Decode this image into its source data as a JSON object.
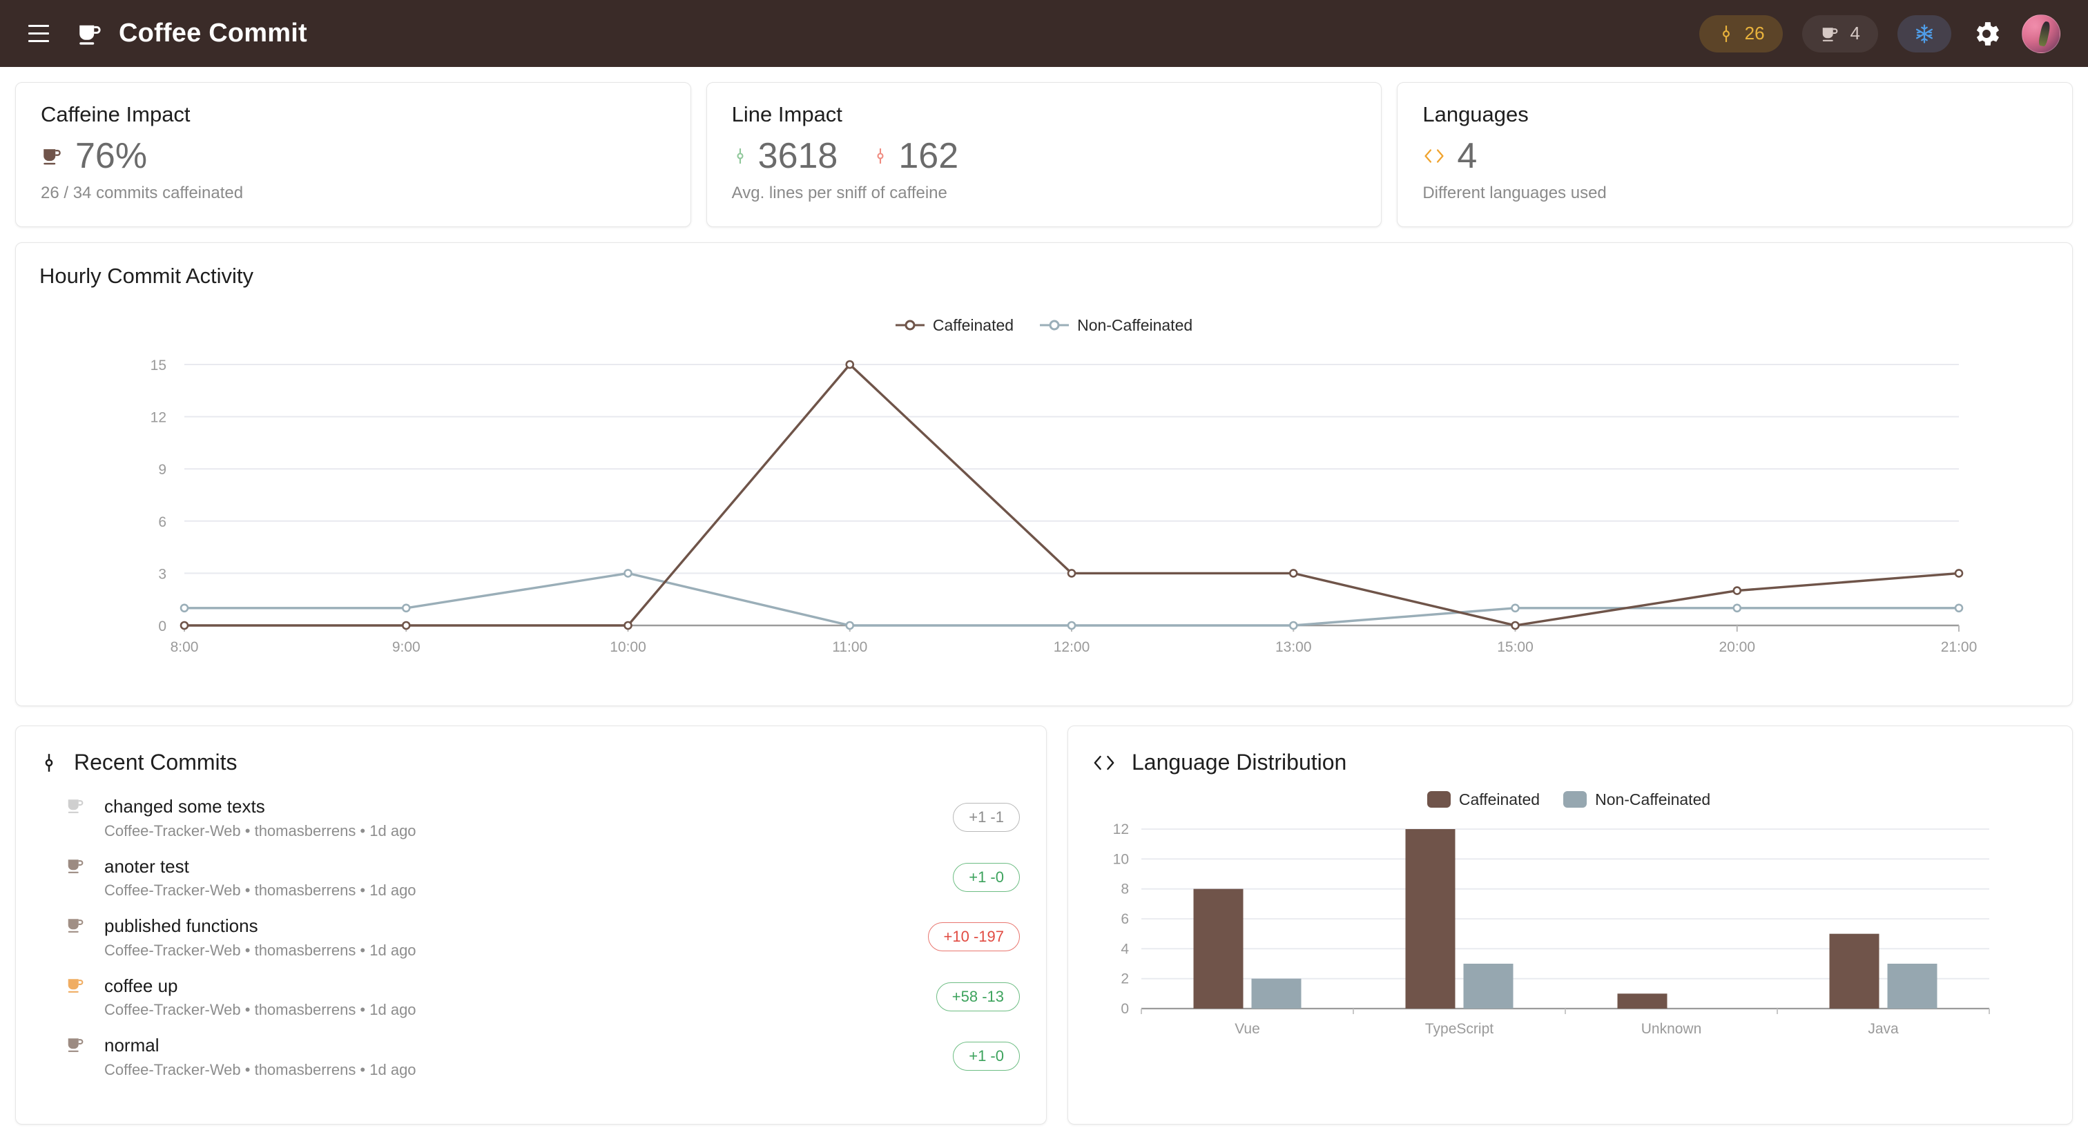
{
  "header": {
    "menu_icon": "hamburger-menu-icon",
    "logo_icon": "coffee-cup-icon",
    "title": "Coffee Commit",
    "badges": {
      "commits_icon": "git-commit-icon",
      "commits_count": "26",
      "coffee_icon": "coffee-cup-icon",
      "coffee_count": "4",
      "snowflake_icon": "snowflake-icon",
      "settings_icon": "gear-icon",
      "avatar": "user-avatar"
    },
    "colors": {
      "bar_bg": "#3a2b28",
      "commit_accent": "#e9b33c",
      "snowflake_accent": "#4f9de8"
    }
  },
  "stats": [
    {
      "title": "Caffeine Impact",
      "icon": "coffee-cup-icon",
      "value": "76%",
      "subtitle": "26 / 34 commits caffeinated"
    },
    {
      "title": "Line Impact",
      "added_icon": "git-commit-icon",
      "added_value": "3618",
      "removed_icon": "git-commit-icon",
      "removed_value": "162",
      "subtitle": "Avg. lines per sniff of caffeine",
      "added_color": "#8fc79a",
      "removed_color": "#ef8b80"
    },
    {
      "title": "Languages",
      "icon": "code-brackets-icon",
      "value": "4",
      "subtitle": "Different languages used",
      "icon_color": "#f0a32e"
    }
  ],
  "hourly": {
    "title": "Hourly Commit Activity",
    "legend": [
      "Caffeinated",
      "Non-Caffeinated"
    ]
  },
  "commits_panel": {
    "icon": "git-commit-icon",
    "title": "Recent Commits",
    "items": [
      {
        "message": "changed some texts",
        "meta": "Coffee-Tracker-Web • thomasberrens • 1d ago",
        "badge": "+1 -1",
        "badge_style": "neutral",
        "icon": "coffee-cup-icon",
        "icon_color": "#cfcfcf"
      },
      {
        "message": "anoter test",
        "meta": "Coffee-Tracker-Web • thomasberrens • 1d ago",
        "badge": "+1 -0",
        "badge_style": "green",
        "icon": "coffee-cup-icon",
        "icon_color": "#9c8b82"
      },
      {
        "message": "published functions",
        "meta": "Coffee-Tracker-Web • thomasberrens • 1d ago",
        "badge": "+10 -197",
        "badge_style": "red",
        "icon": "coffee-cup-icon",
        "icon_color": "#a08f85"
      },
      {
        "message": "coffee up",
        "meta": "Coffee-Tracker-Web • thomasberrens • 1d ago",
        "badge": "+58 -13",
        "badge_style": "green",
        "icon": "coffee-cup-icon",
        "icon_color": "#f0ad62"
      },
      {
        "message": "normal",
        "meta": "Coffee-Tracker-Web • thomasberrens • 1d ago",
        "badge": "+1 -0",
        "badge_style": "green",
        "icon": "coffee-cup-icon",
        "icon_color": "#9c8b82"
      }
    ]
  },
  "language_panel": {
    "icon": "code-brackets-icon",
    "title": "Language Distribution",
    "legend": [
      "Caffeinated",
      "Non-Caffeinated"
    ]
  },
  "chart_data": [
    {
      "type": "line",
      "title": "Hourly Commit Activity",
      "categories": [
        "8:00",
        "9:00",
        "10:00",
        "11:00",
        "12:00",
        "13:00",
        "15:00",
        "20:00",
        "21:00"
      ],
      "series": [
        {
          "name": "Caffeinated",
          "values": [
            0,
            0,
            0,
            15,
            3,
            3,
            0,
            2,
            3
          ],
          "color": "#6f5449"
        },
        {
          "name": "Non-Caffeinated",
          "values": [
            1,
            1,
            3,
            0,
            0,
            0,
            1,
            1,
            1
          ],
          "color": "#9aaeb8"
        }
      ],
      "xlabel": "",
      "ylabel": "",
      "ylim": [
        0,
        15
      ],
      "yticks": [
        0,
        3,
        6,
        9,
        12,
        15
      ],
      "grid": true,
      "legend_position": "top-center"
    },
    {
      "type": "bar",
      "title": "Language Distribution",
      "categories": [
        "Vue",
        "TypeScript",
        "Unknown",
        "Java"
      ],
      "series": [
        {
          "name": "Caffeinated",
          "values": [
            8,
            12,
            1,
            5
          ],
          "color": "#70544a"
        },
        {
          "name": "Non-Caffeinated",
          "values": [
            2,
            3,
            0,
            3
          ],
          "color": "#96a7b0"
        }
      ],
      "xlabel": "",
      "ylabel": "",
      "ylim": [
        0,
        12
      ],
      "yticks": [
        0,
        2,
        4,
        6,
        8,
        10,
        12
      ],
      "grid": true,
      "legend_position": "top-center"
    }
  ]
}
